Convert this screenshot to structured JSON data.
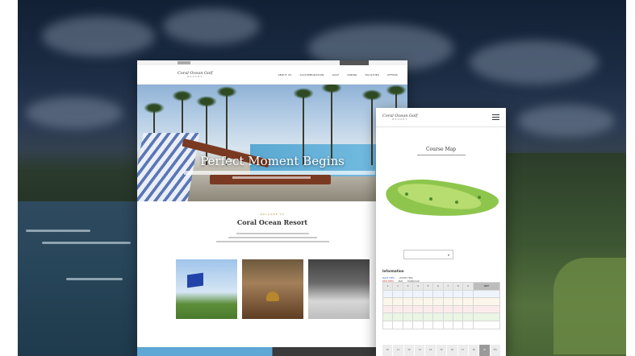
{
  "brand": {
    "logo_text": "Coral Ocean Golf",
    "logo_sub": "RESORT"
  },
  "desktop": {
    "menu": [
      "ABOUT US",
      "ACCOMMODATION",
      "GOLF",
      "DINING",
      "FACILITIES",
      "OFFERS"
    ],
    "hero_title": "Perfect Moment Begins",
    "welcome_tag": "WELCOME TO",
    "welcome_title": "Coral Ocean Resort"
  },
  "mobile": {
    "page_title": "Course Map",
    "info_label": "Information",
    "legend": [
      {
        "label": "BLUE TEES",
        "color": "#3a6fd8"
      },
      {
        "label": "WHITE TEES",
        "color": "#555555"
      },
      {
        "label": "RED TEES",
        "color": "#d23b3b"
      },
      {
        "label": "PAR",
        "color": "#555555"
      },
      {
        "label": "HANDICAP",
        "color": "#555555"
      }
    ],
    "score_header": [
      "1",
      "2",
      "3",
      "4",
      "5",
      "6",
      "7",
      "8",
      "9",
      "OUT"
    ],
    "footer_cells": [
      "10",
      "11",
      "12",
      "13",
      "14",
      "15",
      "16",
      "17",
      "18",
      "IN",
      "TTL"
    ]
  },
  "colors": {
    "accent": "#c98a3a",
    "map_green": "#8ec64d"
  }
}
